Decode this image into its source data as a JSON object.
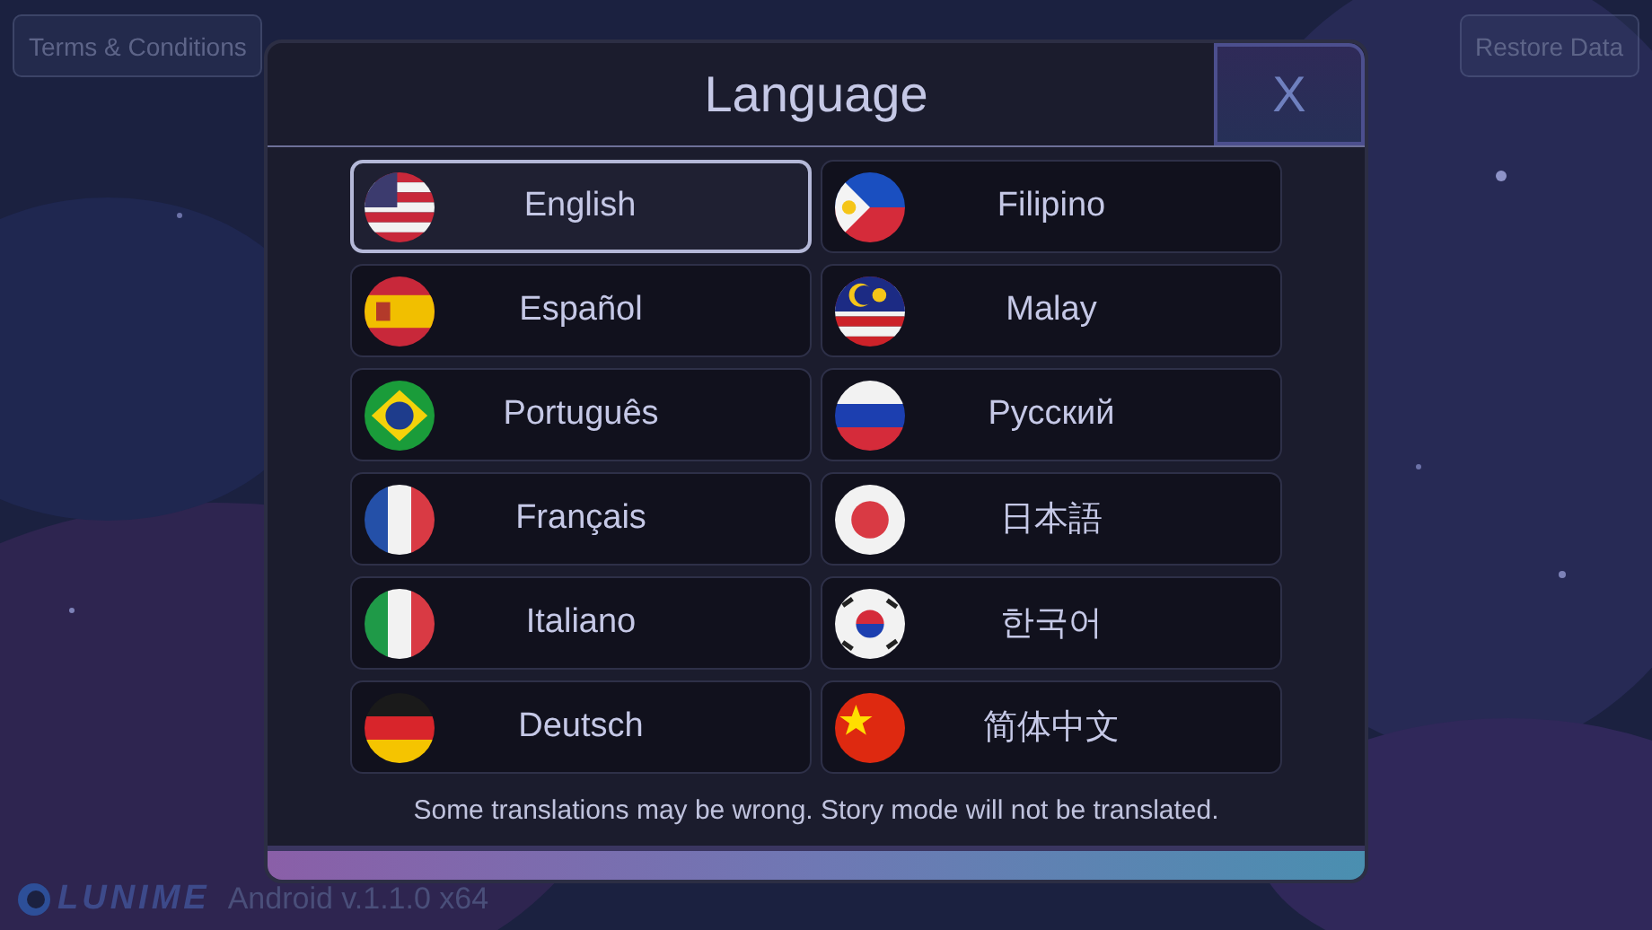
{
  "top_bar": {
    "left_button": "Terms & Conditions",
    "right_button": "Restore Data"
  },
  "dialog": {
    "title": "Language",
    "close_button": "X",
    "languages": [
      {
        "label": "English",
        "selected": true
      },
      {
        "label": "Filipino",
        "selected": false
      },
      {
        "label": "Español",
        "selected": false
      },
      {
        "label": "Malay",
        "selected": false
      },
      {
        "label": "Português",
        "selected": false
      },
      {
        "label": "Русский",
        "selected": false
      },
      {
        "label": "Français",
        "selected": false
      },
      {
        "label": "日本語",
        "selected": false
      },
      {
        "label": "Italiano",
        "selected": false
      },
      {
        "label": "한국어",
        "selected": false
      },
      {
        "label": "Deutsch",
        "selected": false
      },
      {
        "label": "简体中文",
        "selected": false
      }
    ],
    "note": "Some translations may be wrong. Story mode will not be translated."
  },
  "footer": {
    "logo": "LUNIME",
    "version": "Android v.1.1.0 x64"
  }
}
